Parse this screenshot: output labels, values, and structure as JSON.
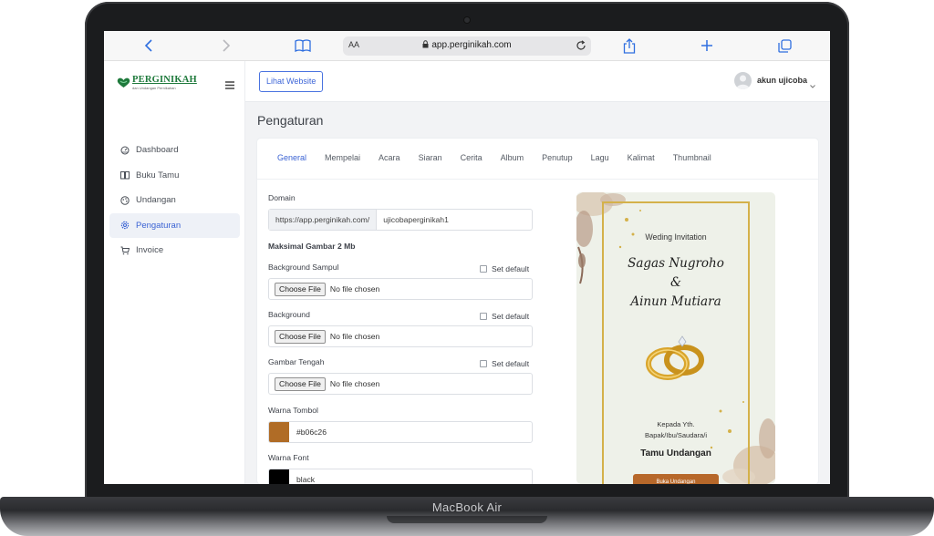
{
  "device": {
    "label": "MacBook Air"
  },
  "browser": {
    "text_size_label": "AA",
    "url": "app.perginikah.com"
  },
  "brand": {
    "name": "PERGINIKAH",
    "tagline": "dan Undangan Pernikahan"
  },
  "sidebar": {
    "items": [
      {
        "label": "Dashboard",
        "icon": "dashboard-icon",
        "active": false
      },
      {
        "label": "Buku Tamu",
        "icon": "book-icon",
        "active": false
      },
      {
        "label": "Undangan",
        "icon": "palette-icon",
        "active": false
      },
      {
        "label": "Pengaturan",
        "icon": "gear-icon",
        "active": true
      },
      {
        "label": "Invoice",
        "icon": "cart-icon",
        "active": false
      }
    ]
  },
  "topbar": {
    "visit_button": "Lihat Website",
    "user_name": "akun ujicoba"
  },
  "page": {
    "title": "Pengaturan"
  },
  "tabs": [
    "General",
    "Mempelai",
    "Acara",
    "Siaran",
    "Cerita",
    "Album",
    "Penutup",
    "Lagu",
    "Kalimat",
    "Thumbnail"
  ],
  "form": {
    "domain_label": "Domain",
    "domain_prefix": "https://app.perginikah.com/",
    "domain_value": "ujicobaperginikah1",
    "max_image_label": "Maksimal Gambar 2 Mb",
    "choose_file_label": "Choose File",
    "no_file_label": "No file chosen",
    "set_default_label": "Set default",
    "background_cover_label": "Background Sampul",
    "background_label": "Background",
    "center_image_label": "Gambar Tengah",
    "button_color_label": "Warna Tombol",
    "button_color_value": "#b06c26",
    "font_color_label": "Warna Font",
    "font_color_value": "black"
  },
  "preview": {
    "title": "Weding Invitation",
    "groom": "Sagas Nugroho",
    "ampersand": "&",
    "bride": "Ainun Mutiara",
    "to_line1": "Kepada Yth.",
    "to_line2": "Bapak/Ibu/Saudara/i",
    "guest": "Tamu Undangan",
    "open_button": "Buka Undangan"
  },
  "colors": {
    "accent": "#3b63d4",
    "brand_green": "#1f7a3c",
    "button_color": "#b06c26",
    "font_color": "#000000"
  }
}
